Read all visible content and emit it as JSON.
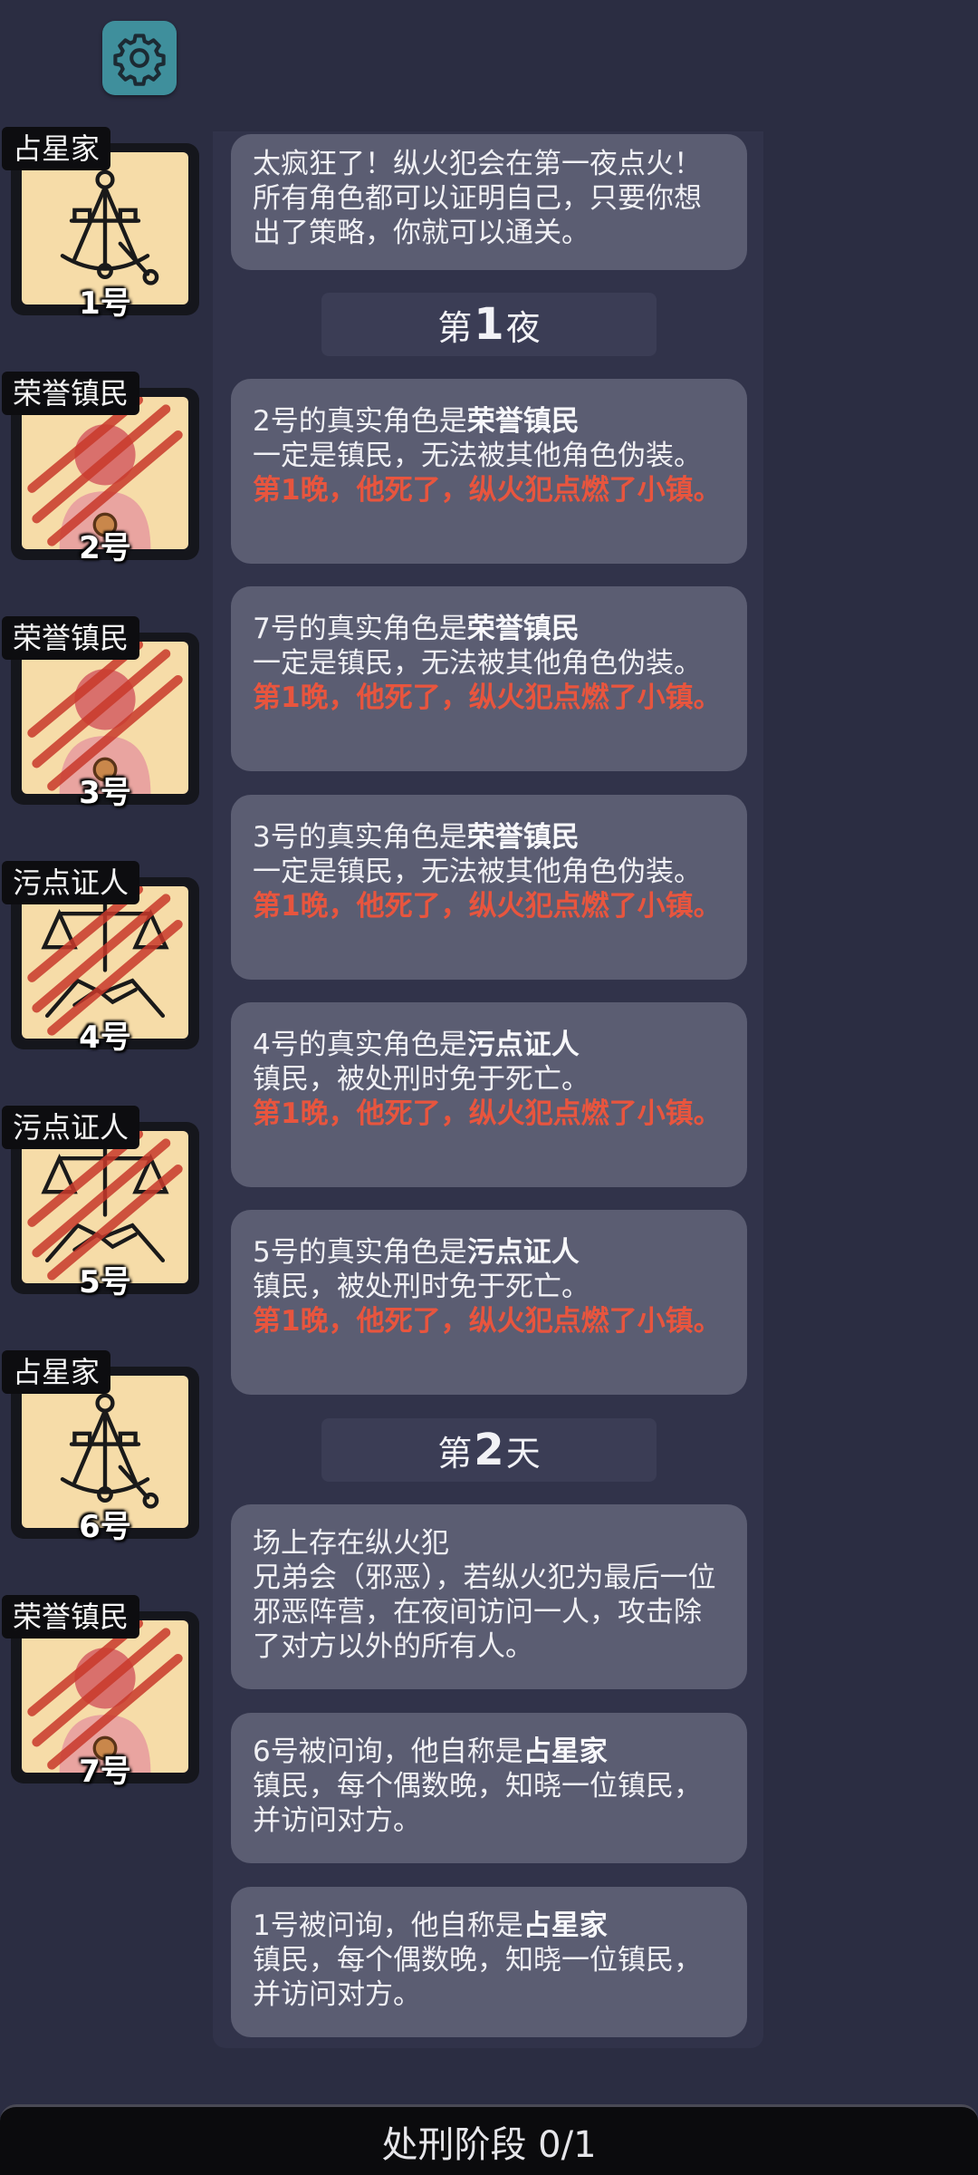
{
  "players": [
    {
      "role": "占星家",
      "seat": "1号",
      "icon": "sextant-icon",
      "dead": false
    },
    {
      "role": "荣誉镇民",
      "seat": "2号",
      "icon": "honor-townsman-icon",
      "dead": true
    },
    {
      "role": "荣誉镇民",
      "seat": "3号",
      "icon": "honor-townsman-icon",
      "dead": true
    },
    {
      "role": "污点证人",
      "seat": "4号",
      "icon": "scales-handshake-icon",
      "dead": true
    },
    {
      "role": "污点证人",
      "seat": "5号",
      "icon": "scales-handshake-icon",
      "dead": true
    },
    {
      "role": "占星家",
      "seat": "6号",
      "icon": "sextant-icon",
      "dead": false
    },
    {
      "role": "荣誉镇民",
      "seat": "7号",
      "icon": "honor-townsman-icon",
      "dead": true
    }
  ],
  "log": {
    "intro": "太疯狂了！纵火犯会在第一夜点火！所有角色都可以证明自己，只要你想出了策略，你就可以通关。",
    "night1": {
      "prefix": "第",
      "num": "1",
      "suffix": "夜"
    },
    "entries": [
      {
        "title_pre": "2号的真实角色是",
        "title_role": "荣誉镇民",
        "desc": "一定是镇民，无法被其他角色伪装。",
        "death": "第1晚，他死了，纵火犯点燃了小镇。"
      },
      {
        "title_pre": "7号的真实角色是",
        "title_role": "荣誉镇民",
        "desc": "一定是镇民，无法被其他角色伪装。",
        "death": "第1晚，他死了，纵火犯点燃了小镇。"
      },
      {
        "title_pre": "3号的真实角色是",
        "title_role": "荣誉镇民",
        "desc": "一定是镇民，无法被其他角色伪装。",
        "death": "第1晚，他死了，纵火犯点燃了小镇。"
      },
      {
        "title_pre": "4号的真实角色是",
        "title_role": "污点证人",
        "desc": "镇民，被处刑时免于死亡。",
        "death": "第1晚，他死了，纵火犯点燃了小镇。"
      },
      {
        "title_pre": "5号的真实角色是",
        "title_role": "污点证人",
        "desc": "镇民，被处刑时免于死亡。",
        "death": "第1晚，他死了，纵火犯点燃了小镇。"
      }
    ],
    "day2": {
      "prefix": "第",
      "num": "2",
      "suffix": "天"
    },
    "arsonist": {
      "title": "场上存在纵火犯",
      "desc": "兄弟会（邪恶），若纵火犯为最后一位邪恶阵营，在夜间访问一人，攻击除了对方以外的所有人。"
    },
    "claims": [
      {
        "title_pre": "6号被问询，他自称是",
        "title_role": "占星家",
        "desc": "镇民，每个偶数晚，知晓一位镇民，并访问对方。"
      },
      {
        "title_pre": "1号被问询，他自称是",
        "title_role": "占星家",
        "desc": "镇民，每个偶数晚，知晓一位镇民，并访问对方。"
      }
    ]
  },
  "bottom_bar": {
    "label": "处刑阶段 0/1"
  },
  "colors": {
    "background": "#2b2d42",
    "card": "#5b5d72",
    "death_text": "#e8553e",
    "portrait_bg": "#f6dca8",
    "settings": "#3f8f9c"
  }
}
